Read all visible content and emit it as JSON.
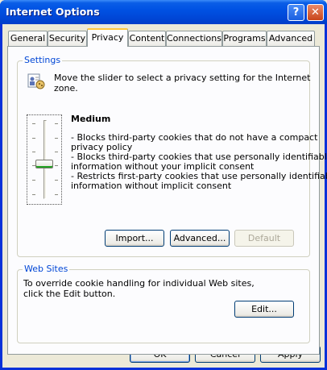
{
  "window": {
    "title": "Internet Options",
    "help_glyph": "?",
    "close_glyph": "✕"
  },
  "tabs": [
    {
      "label": "General"
    },
    {
      "label": "Security"
    },
    {
      "label": "Privacy",
      "selected": true
    },
    {
      "label": "Content"
    },
    {
      "label": "Connections"
    },
    {
      "label": "Programs"
    },
    {
      "label": "Advanced"
    }
  ],
  "settings": {
    "group_label": "Settings",
    "intro_line1": "Move the slider to select a privacy setting for the Internet",
    "intro_line2": "zone.",
    "level_title": "Medium",
    "slider_level": 3,
    "slider_levels_total": 6,
    "description_lines": [
      "- Blocks third-party cookies that do not have a compact",
      "privacy policy",
      "- Blocks third-party cookies that use personally identifiable",
      "information without your implicit consent",
      "- Restricts first-party cookies that use personally identifiable",
      "information without implicit consent"
    ],
    "import_button": "Import...",
    "advanced_button": "Advanced...",
    "default_button": "Default"
  },
  "websites": {
    "group_label": "Web Sites",
    "text_line1": "To override cookie handling for individual Web sites,",
    "text_line2": "click the Edit button.",
    "edit_button": "Edit..."
  },
  "footer": {
    "ok_button": "OK",
    "cancel_button": "Cancel",
    "apply_button": "Apply"
  },
  "colors": {
    "titlebar": "#0052e3",
    "group_label": "#0046d5",
    "active_tab_highlight": "#ffc83c"
  }
}
